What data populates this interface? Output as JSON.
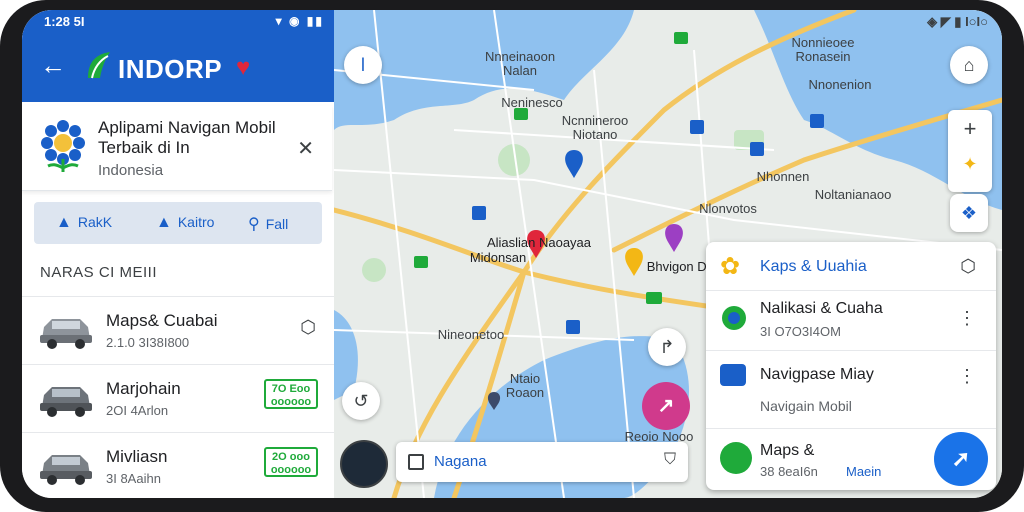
{
  "status_left": {
    "time": "1:28 5I",
    "icons": "▾ ◉ ▮▮"
  },
  "status_right": {
    "text": "◈ ◤ ▮ I○I○"
  },
  "app": {
    "back_icon": "←",
    "brand": "INDORP",
    "heart": "♥"
  },
  "info_card": {
    "title": "Aplipami Navigan Mobil Terbaik di In",
    "subtitle": "Indonesia",
    "close": "✕"
  },
  "actions": [
    {
      "label": "RakK",
      "icon": "▲"
    },
    {
      "label": "Kaitro",
      "icon": "▲"
    },
    {
      "label": "Fall",
      "icon": "⚲"
    }
  ],
  "section_title": "NARAS CI MEIII",
  "list": [
    {
      "name": "Maps& Cuabai",
      "sub": "2.1.0 3I38I800",
      "trail": "⬡"
    },
    {
      "name": "Marjohain",
      "sub": "2OI 4Arlon",
      "badge": "7O Eoo oooooo"
    },
    {
      "name": "Mivliasn",
      "sub": "3I 8Aaihn",
      "badge": "2O ooo oooooo"
    }
  ],
  "map": {
    "labels": [
      {
        "text": "Nonnieoee Ronasein"
      },
      {
        "text": "Nnneinaoon Nalan"
      },
      {
        "text": "Ncnnineroo Niotano"
      },
      {
        "text": "Nnonenion"
      },
      {
        "text": "Neninesco"
      },
      {
        "text": "Nhonnen"
      },
      {
        "text": "Noltanianaoo"
      },
      {
        "text": "Nlonvotos"
      },
      {
        "text": "Aliaslian Naoayaa"
      },
      {
        "text": "Midonsan"
      },
      {
        "text": "Bhvigon Dvio"
      },
      {
        "text": "Nineonetoo"
      },
      {
        "text": "Ntaio Roaon"
      },
      {
        "text": "Reoio Nooo"
      }
    ],
    "search": {
      "placeholder": "Nagana"
    }
  },
  "sheet": [
    {
      "title": "Kaps & Uuahia",
      "trail": "⬡"
    },
    {
      "title": "Nalikasi & Cuaha",
      "sub": "3I O7O3I4OM",
      "trail": "⋮"
    },
    {
      "title": "Navigpase Miay",
      "sub": "Navigain Mobil",
      "trail": "⋮"
    },
    {
      "title": "Maps &",
      "sub": "38 8eaI6n",
      "extra": "Maein"
    }
  ],
  "colors": {
    "primary": "#1a5fc8",
    "water": "#8fc1ef",
    "road": "#f3c660",
    "accent": "#d03a8c"
  }
}
